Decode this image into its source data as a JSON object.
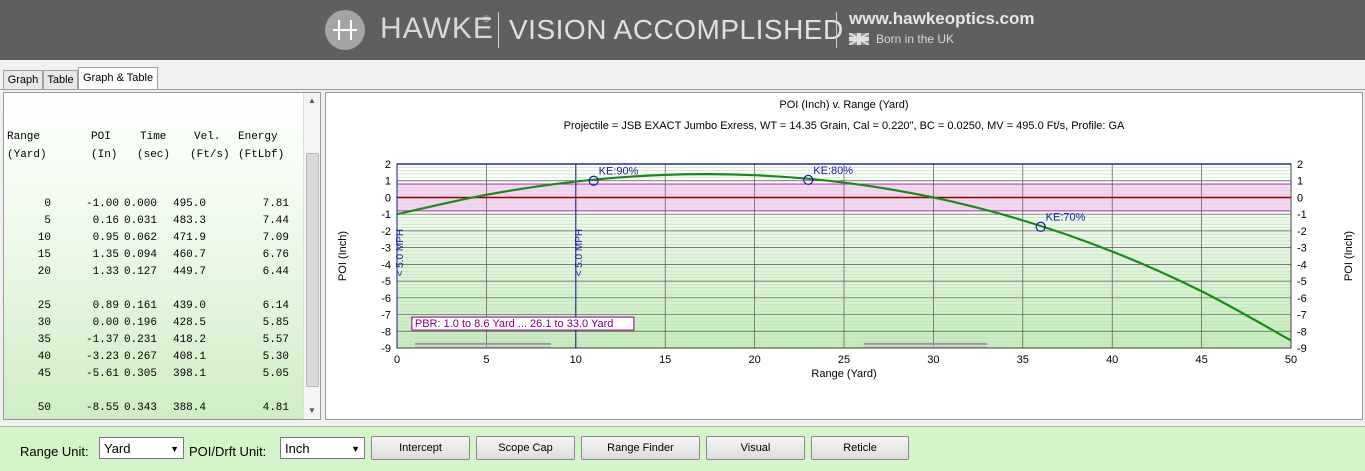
{
  "banner": {
    "brand": "HAWKE",
    "registered": "®",
    "tagline": "VISION ACCOMPLISHED",
    "url": "www.hawkeoptics.com",
    "born": "Born in the UK",
    "logo_icon": "hawke-logo-icon",
    "flag_icon": "uk-flag-icon"
  },
  "tabs": [
    {
      "label": "Graph"
    },
    {
      "label": "Table"
    },
    {
      "label": "Graph & Table",
      "active": true
    }
  ],
  "table": {
    "headers": [
      [
        "Range",
        "(Yard)"
      ],
      [
        "POI",
        "(In)"
      ],
      [
        "Time",
        "(sec)"
      ],
      [
        "Vel.",
        "(Ft/s)"
      ],
      [
        "Energy",
        "(FtLbf)"
      ]
    ],
    "rows": [
      [
        "0",
        "-1.00",
        "0.000",
        "495.0",
        "7.81"
      ],
      [
        "5",
        "0.16",
        "0.031",
        "483.3",
        "7.44"
      ],
      [
        "10",
        "0.95",
        "0.062",
        "471.9",
        "7.09"
      ],
      [
        "15",
        "1.35",
        "0.094",
        "460.7",
        "6.76"
      ],
      [
        "20",
        "1.33",
        "0.127",
        "449.7",
        "6.44"
      ],
      [
        "25",
        "0.89",
        "0.161",
        "439.0",
        "6.14"
      ],
      [
        "30",
        "0.00",
        "0.196",
        "428.5",
        "5.85"
      ],
      [
        "35",
        "-1.37",
        "0.231",
        "418.2",
        "5.57"
      ],
      [
        "40",
        "-3.23",
        "0.267",
        "408.1",
        "5.30"
      ],
      [
        "45",
        "-5.61",
        "0.305",
        "398.1",
        "5.05"
      ],
      [
        "50",
        "-8.55",
        "0.343",
        "388.4",
        "4.81"
      ]
    ]
  },
  "chart_data": {
    "type": "line",
    "title": "POI (Inch) v. Range (Yard)",
    "subtitle": "Projectile = JSB EXACT Jumbo Exress, WT = 14.35 Grain, Cal = 0.220\", BC = 0.0250, MV = 495.0 Ft/s, Profile: GA",
    "xlabel": "Range (Yard)",
    "ylabel_left": "POI (Inch)",
    "ylabel_right": "POI (Inch)",
    "xlim": [
      0,
      50
    ],
    "ylim": [
      -9,
      2
    ],
    "x_ticks": [
      "0",
      "5",
      "10",
      "15",
      "20",
      "25",
      "30",
      "35",
      "40",
      "45",
      "50"
    ],
    "y_ticks": [
      "2",
      "1",
      "0",
      "-1",
      "-2",
      "-3",
      "-4",
      "-5",
      "-6",
      "-7",
      "-8",
      "-9"
    ],
    "grid": true,
    "series": [
      {
        "x": [
          0,
          5,
          10,
          15,
          20,
          25,
          30,
          35,
          40,
          45,
          50
        ],
        "y": [
          -1.0,
          0.16,
          0.95,
          1.35,
          1.33,
          0.89,
          0.0,
          -1.37,
          -3.23,
          -5.61,
          -8.55
        ],
        "color": "#1a8a1a"
      }
    ],
    "markers": [
      {
        "label": "KE:90%",
        "x": 11,
        "y": 1.0
      },
      {
        "label": "KE:80%",
        "x": 23,
        "y": 1.05
      },
      {
        "label": "KE:70%",
        "x": 36,
        "y": -1.75
      }
    ],
    "wind_lines": [
      {
        "label": "< 5.0 MPH",
        "x": 0
      },
      {
        "label": "< 5.0 MPH",
        "x": 10
      }
    ],
    "pbr_band": {
      "top": 0.8,
      "bottom": -0.8,
      "color": "#c040c0"
    },
    "pbr_label": "PBR: 1.0 to 8.6 Yard ... 26.1 to 33.0 Yard",
    "pbr_ranges": [
      [
        1.0,
        8.6
      ],
      [
        26.1,
        33.0
      ]
    ],
    "zero_line_color": "#8b0000"
  },
  "bottombar": {
    "range_unit_label": "Range Unit:",
    "range_unit_value": "Yard",
    "poi_unit_label": "POI/Drft Unit:",
    "poi_unit_value": "Inch",
    "buttons": [
      "Intercept",
      "Scope Cap",
      "Range Finder",
      "Visual",
      "Reticle"
    ]
  }
}
